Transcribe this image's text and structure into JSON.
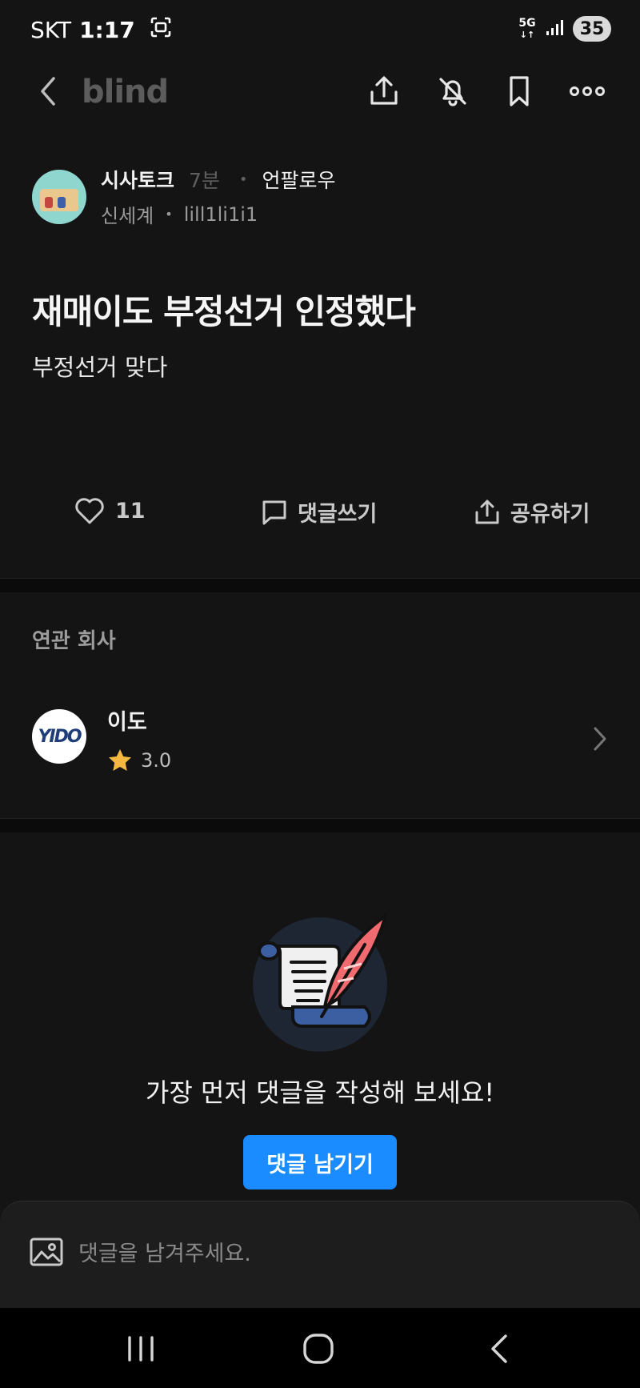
{
  "status_bar": {
    "carrier": "SKT",
    "time": "1:17",
    "network": "5G",
    "battery": "35"
  },
  "nav": {
    "logo": "blind"
  },
  "author": {
    "board": "시사토크",
    "time_ago": "7분",
    "follow_label": "언팔로우",
    "company": "신세계",
    "nickname": "lill1li1i1"
  },
  "post": {
    "title": "재매이도 부정선거 인정했다",
    "body": "부정선거 맞다"
  },
  "actions": {
    "like_count": "11",
    "comment_label": "댓글쓰기",
    "share_label": "공유하기"
  },
  "related": {
    "heading": "연관 회사",
    "company": {
      "name": "이도",
      "rating": "3.0",
      "logo_text": "YIDO"
    }
  },
  "empty_comments": {
    "message": "가장 먼저 댓글을 작성해 보세요!",
    "button_label": "댓글 남기기"
  },
  "comment_bar": {
    "placeholder": "댓글을 남겨주세요."
  },
  "colors": {
    "background": "#141414",
    "accent": "#1a8cff",
    "star": "#f5b942"
  }
}
